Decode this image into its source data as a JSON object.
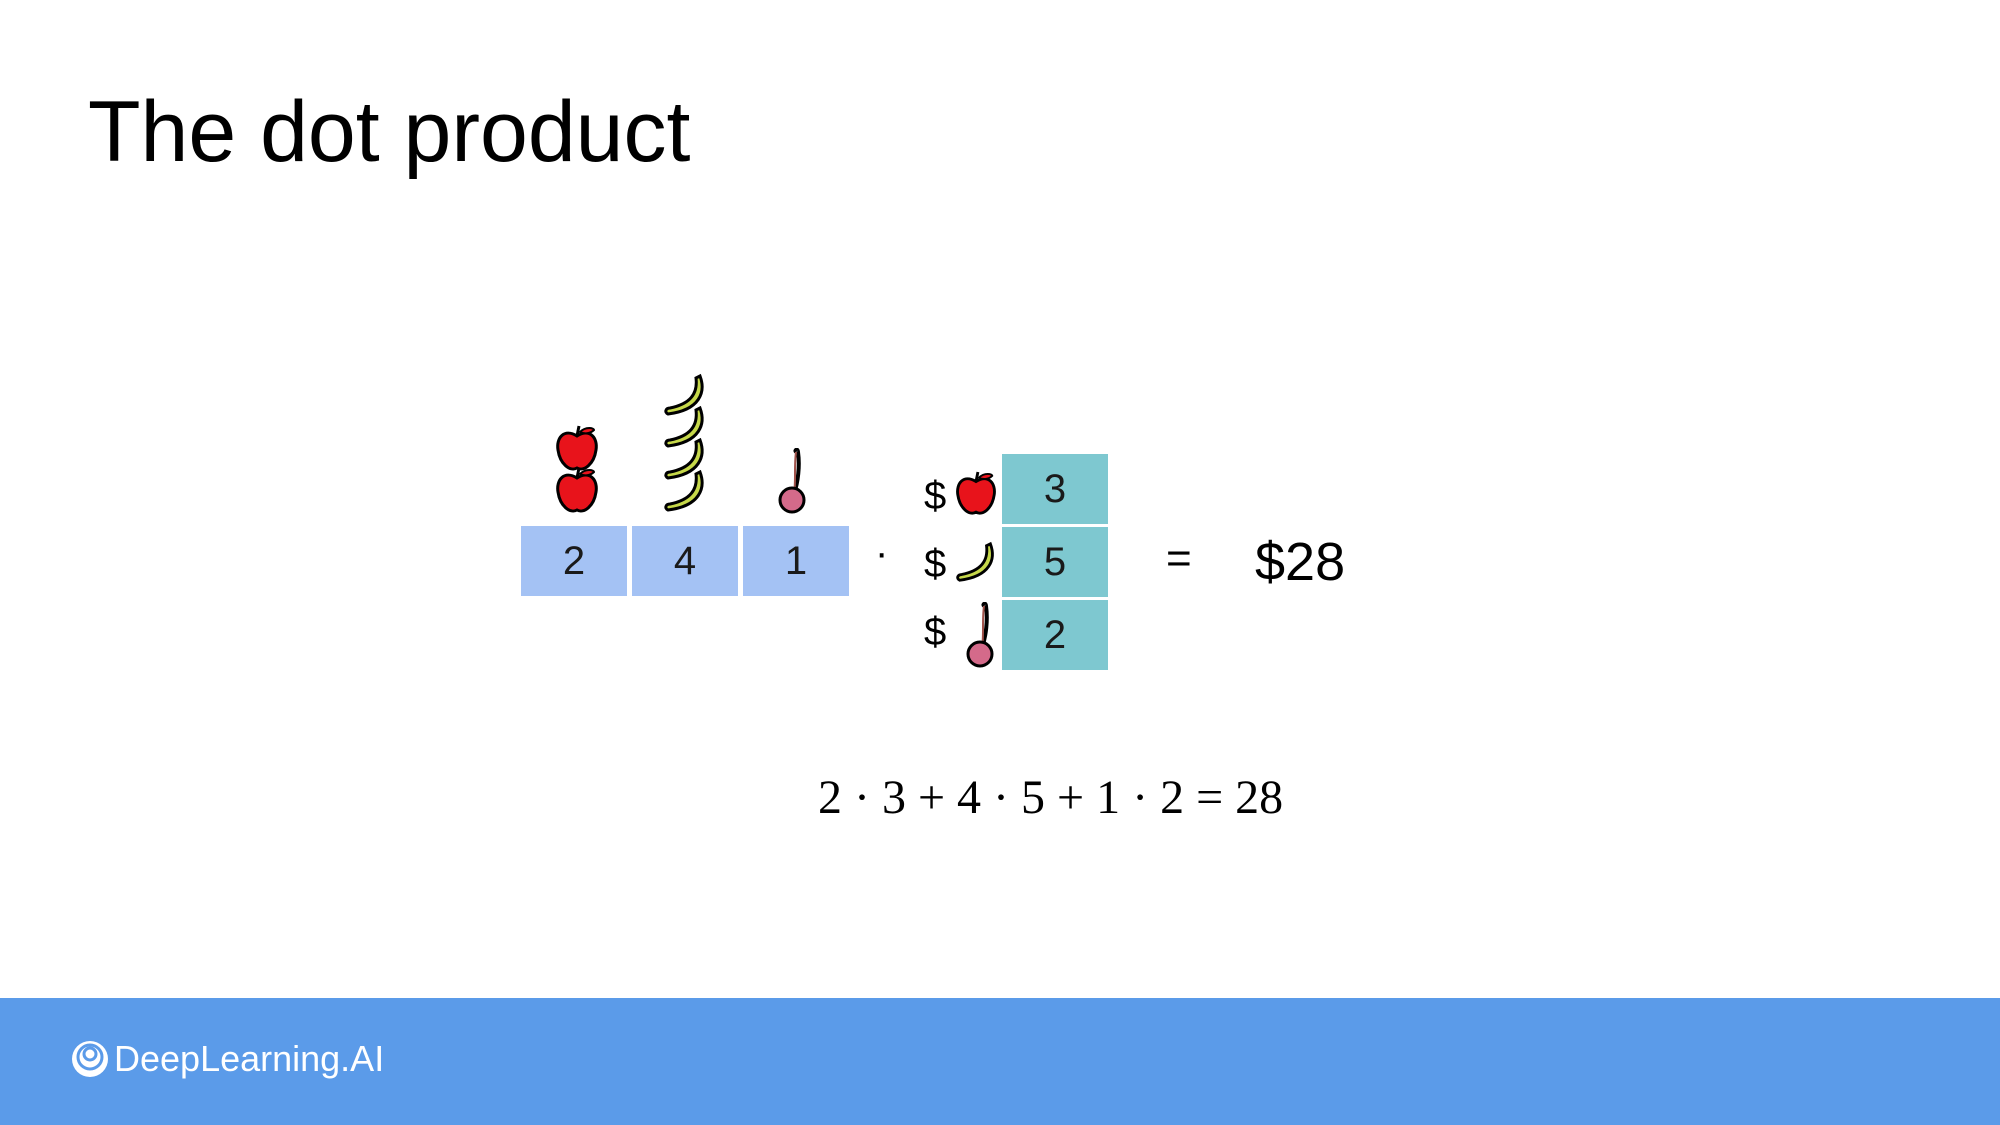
{
  "title": "The dot product",
  "quantities": {
    "values": [
      "2",
      "4",
      "1"
    ],
    "items": [
      {
        "fruit": "apple",
        "count": 2
      },
      {
        "fruit": "banana",
        "count": 4
      },
      {
        "fruit": "cherry",
        "count": 1
      }
    ]
  },
  "dot_symbol": "·",
  "prices": {
    "currency": "$",
    "values": [
      "3",
      "5",
      "2"
    ],
    "fruits": [
      "apple-icon",
      "banana-icon",
      "cherry-icon"
    ]
  },
  "equals_symbol": "=",
  "result": "$28",
  "equation": "2 · 3 + 4 · 5 + 1 · 2 = 28",
  "footer": {
    "brand": "DeepLearning.AI"
  },
  "colors": {
    "row_vector": "#a4c2f4",
    "column_vector": "#7ec8d0",
    "footer_bar": "#5b9be9"
  }
}
